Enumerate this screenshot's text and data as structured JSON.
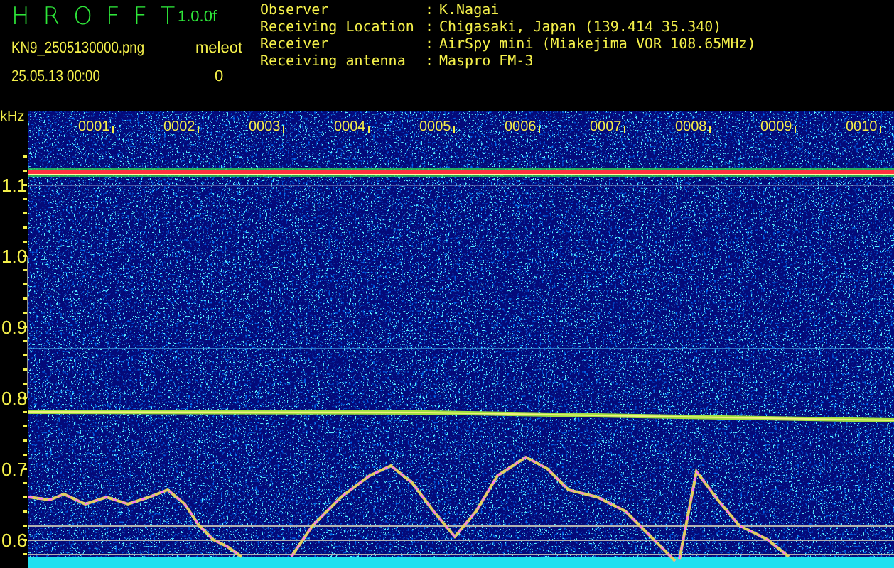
{
  "header": {
    "app_title": "HROFFT",
    "version": "1.0.0f",
    "file_name": "KN9_2505130000.png",
    "meteor_label": "meleot",
    "datetime": "25.05.13 00:00",
    "meteor_count": "0"
  },
  "info": [
    {
      "label": "Observer",
      "separator": ":",
      "value": "K.Nagai"
    },
    {
      "label": "Receiving Location",
      "separator": ":",
      "value": "Chigasaki, Japan (139.414 35.340)"
    },
    {
      "label": "Receiver",
      "separator": ":",
      "value": "AirSpy mini (Miakejima VOR 108.65MHz)"
    },
    {
      "label": "Receiving antenna",
      "separator": ":",
      "value": "Maspro FM-3"
    }
  ],
  "spectrogram": {
    "y_unit": "kHz",
    "y_labels": [
      "1.1",
      "1.0",
      "0.9",
      "0.8",
      "0.7",
      "0.6"
    ],
    "time_labels": [
      "0001",
      "0002",
      "0003",
      "0004",
      "0005",
      "0006",
      "0007",
      "0008",
      "0009",
      "0010"
    ]
  }
}
